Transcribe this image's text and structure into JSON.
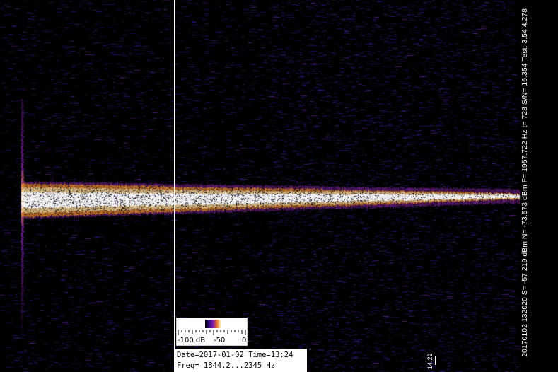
{
  "colors": {
    "background": "#000000",
    "signal_core": "#ffffff",
    "signal_warm": "#f5a23a",
    "signal_mid": "#8a2bb5",
    "noise": "#2a1a8a"
  },
  "scale": {
    "label_min": "-100 dB",
    "label_mid": "-50",
    "label_max": "0"
  },
  "info": {
    "line1": "Date=2017-01-02 Time=13:24",
    "line2": "Freq= 1844.2...2345 Hz"
  },
  "status": {
    "text": "20170102 132020 S= -57.219 dBm N= -73.573 dBm F= 1957.722 Hz t= 728   S/N= 16.354 Test: 3.54 4.278"
  },
  "time_marker": {
    "label": "14:22"
  }
}
